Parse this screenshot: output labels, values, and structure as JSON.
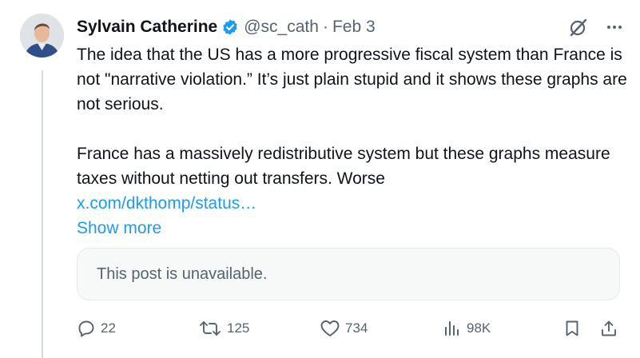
{
  "post": {
    "author_name": "Sylvain Catherine",
    "handle": "@sc_cath",
    "separator": "·",
    "date": "Feb 3",
    "paragraph_1": "The idea that the US has a more progressive fiscal system than France is not \"narrative violation.” It’s just plain stupid and it shows these graphs are not serious.",
    "paragraph_2": "France has a massively redistributive system but these graphs measure taxes without netting out transfers. Worse",
    "link_text": "x.com/dkthomp/status…",
    "show_more": "Show more",
    "quoted_post_text": "This post is unavailable."
  },
  "actions": {
    "replies": "22",
    "reposts": "125",
    "likes": "734",
    "views": "98K"
  },
  "colors": {
    "link": "#1d9bf0",
    "secondary_text": "#536471",
    "verified_badge": "#1d9bf0"
  },
  "icons": {
    "verified": "verified-badge-icon",
    "grok": "grok-icon",
    "more": "more-icon",
    "reply": "reply-icon",
    "repost": "repost-icon",
    "like": "like-icon",
    "views": "views-icon",
    "bookmark": "bookmark-icon",
    "share": "share-icon"
  }
}
